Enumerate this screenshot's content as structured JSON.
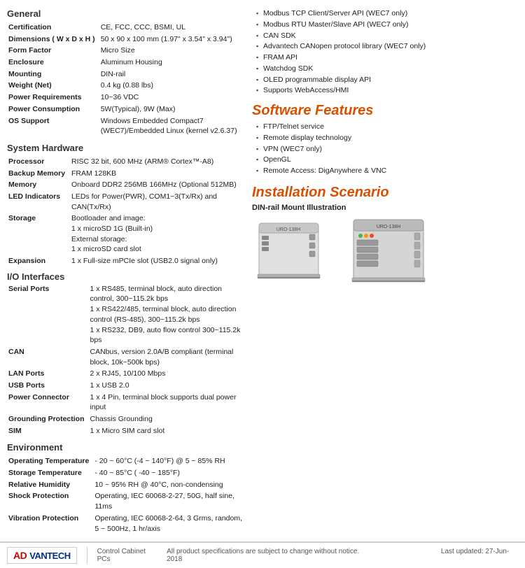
{
  "page": {
    "title": "Control Cabinet PCs",
    "footer_disclaimer": "All product specifications are subject to change without notice.",
    "footer_date": "Last updated: 27-Jun-2018"
  },
  "logo": {
    "brand": "AD",
    "brand_rest": "VANTECH"
  },
  "left": {
    "general_title": "General",
    "general_specs": [
      {
        "label": "Certification",
        "value": "CE, FCC, CCC, BSMI, UL"
      },
      {
        "label": "Dimensions ( W x D x H )",
        "value": "50 x 90 x 100 mm (1.97\" x 3.54\" x 3.94\")"
      },
      {
        "label": "Form Factor",
        "value": "Micro Size"
      },
      {
        "label": "Enclosure",
        "value": "Aluminum Housing"
      },
      {
        "label": "Mounting",
        "value": "DIN-rail"
      },
      {
        "label": "Weight (Net)",
        "value": "0.4 kg (0.88 lbs)"
      },
      {
        "label": "Power Requirements",
        "value": "10~36 VDC"
      },
      {
        "label": "Power Consumption",
        "value": "5W(Typical), 9W (Max)"
      },
      {
        "label": "OS Support",
        "value": "Windows Embedded Compact7 (WEC7)/Embedded Linux (kernel v2.6.37)"
      }
    ],
    "system_title": "System Hardware",
    "system_specs": [
      {
        "label": "Processor",
        "value": "RISC 32 bit, 600 MHz (ARM® Cortex™-A8)"
      },
      {
        "label": "Backup Memory",
        "value": "FRAM 128KB"
      },
      {
        "label": "Memory",
        "value": "Onboard DDR2 256MB 166MHz (Optional 512MB)"
      },
      {
        "label": "LED Indicators",
        "value": "LEDs for Power(PWR), COM1~3(Tx/Rx) and CAN(Tx/Rx)"
      },
      {
        "label": "Storage",
        "value": "Bootloader and image:\n1 x microSD 1G (Built-in)\nExternal storage:\n1 x microSD card slot"
      },
      {
        "label": "Expansion",
        "value": "1 x Full-size mPCIe slot (USB2.0 signal only)"
      }
    ],
    "io_title": "I/O Interfaces",
    "io_specs": [
      {
        "label": "Serial Ports",
        "value": "1 x RS485, terminal block, auto direction control, 300~115.2k bps\n1 x RS422/485, terminal block, auto direction control (RS-485), 300~115.2k bps\n1 x RS232, DB9, auto flow control 300~115.2k bps"
      },
      {
        "label": "CAN",
        "value": "CANbus, version 2.0A/B compliant (terminal block, 10k~500k bps)"
      },
      {
        "label": "LAN Ports",
        "value": "2 x RJ45, 10/100 Mbps"
      },
      {
        "label": "USB Ports",
        "value": "1 x USB 2.0"
      },
      {
        "label": "Power Connector",
        "value": "1 x 4 Pin, terminal block supports dual power input"
      },
      {
        "label": "Grounding Protection",
        "value": "Chassis Grounding"
      },
      {
        "label": "SIM",
        "value": "1 x Micro SIM card slot"
      }
    ],
    "env_title": "Environment",
    "env_specs": [
      {
        "label": "Operating Temperature",
        "value": "- 20 ~ 60°C (-4 ~ 140°F) @ 5 ~ 85% RH"
      },
      {
        "label": "Storage Temperature",
        "value": "- 40 ~ 85°C ( -40 ~ 185°F)"
      },
      {
        "label": "Relative Humidity",
        "value": "10 ~ 95% RH @ 40°C, non-condensing"
      },
      {
        "label": "Shock Protection",
        "value": "Operating, IEC 60068-2-27, 50G, half sine, 11ms"
      },
      {
        "label": "Vibration Protection",
        "value": "Operating, IEC 60068-2-64, 3 Grms, random, 5 ~ 500Hz, 1 hr/axis"
      }
    ]
  },
  "right": {
    "api_bullets": [
      "Modbus TCP Client/Server API (WEC7 only)",
      "Modbus RTU Master/Slave API (WEC7 only)",
      "CAN SDK",
      "Advantech CANopen protocol library (WEC7 only)",
      "FRAM API",
      "Watchdog SDK",
      "OLED programmable display API",
      "Supports WebAccess/HMI"
    ],
    "software_title": "Software Features",
    "software_bullets": [
      "FTP/Telnet service",
      "Remote display technology",
      "VPN (WEC7 only)",
      "OpenGL",
      "Remote Access: DigAnywhere & VNC"
    ],
    "installation_title": "Installation Scenario",
    "dinrail_subtitle": "DIN-rail Mount Illustration"
  }
}
